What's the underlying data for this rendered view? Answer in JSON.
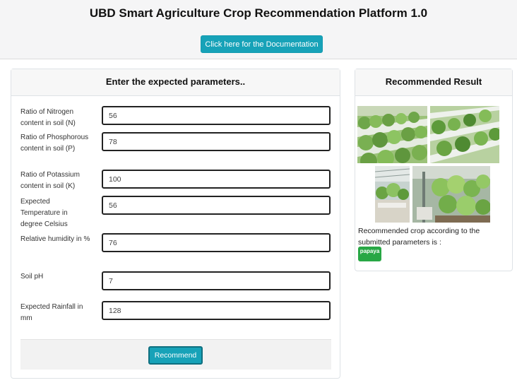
{
  "header": {
    "title": "UBD Smart Agriculture Crop Recommendation Platform 1.0",
    "doc_button": "Click here for the Documentation"
  },
  "form": {
    "title": "Enter the expected parameters..",
    "fields": [
      {
        "label": "Ratio of Nitrogen content in soil (N)",
        "value": "56"
      },
      {
        "label": "Ratio of Phosphorous content in soil (P)",
        "value": "78"
      },
      {
        "label": "Ratio of Potassium content in soil (K)",
        "value": "100"
      },
      {
        "label": "Expected Temperature in degree Celsius",
        "value": "56"
      },
      {
        "label": "Relative humidity in %",
        "value": "76"
      },
      {
        "label": "Soil pH",
        "value": "7"
      },
      {
        "label": "Expected Rainfall in mm",
        "value": "128"
      }
    ],
    "submit_label": "Recommend"
  },
  "result": {
    "title": "Recommended Result",
    "text": "Recommended crop according to the submitted parameters is :",
    "crop": "papaya"
  },
  "colors": {
    "accent": "#17a2b8",
    "badge": "#28a745",
    "header_bg": "#f5f5f6"
  }
}
